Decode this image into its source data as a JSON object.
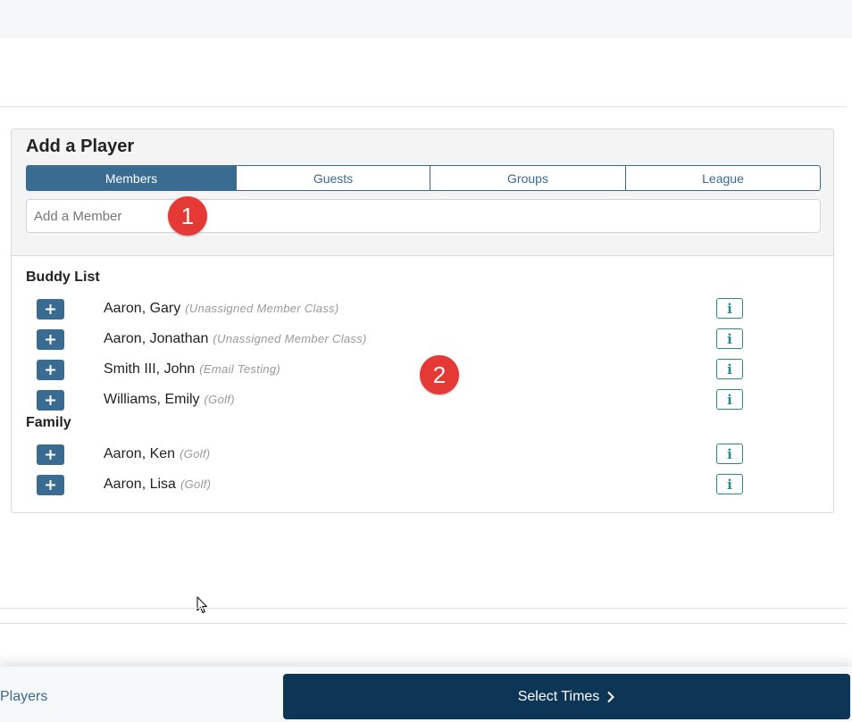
{
  "card": {
    "title": "Add a Player",
    "tabs": [
      {
        "label": "Members",
        "active": true
      },
      {
        "label": "Guests",
        "active": false
      },
      {
        "label": "Groups",
        "active": false
      },
      {
        "label": "League",
        "active": false
      }
    ],
    "search": {
      "placeholder": "Add a Member",
      "value": ""
    },
    "buddy_list": {
      "heading": "Buddy List",
      "members": [
        {
          "name": "Aaron, Gary",
          "class": "(Unassigned Member Class)"
        },
        {
          "name": "Aaron, Jonathan",
          "class": "(Unassigned Member Class)"
        },
        {
          "name": "Smith III, John",
          "class": "(Email Testing)"
        },
        {
          "name": "Williams, Emily",
          "class": "(Golf)"
        }
      ]
    },
    "family": {
      "heading": "Family",
      "members": [
        {
          "name": "Aaron, Ken",
          "class": "(Golf)"
        },
        {
          "name": "Aaron, Lisa",
          "class": "(Golf)"
        }
      ]
    },
    "add_icon": "plus-icon",
    "info_icon": "info-icon",
    "info_label": "i"
  },
  "markers": [
    "1",
    "2"
  ],
  "footer": {
    "players_link": "Players",
    "select_times_label": "Select Times",
    "select_times_icon": "chevron-right-icon"
  },
  "colors": {
    "primary": "#3a6b91",
    "dark_button": "#0d3556",
    "info_accent": "#2a8a8a",
    "marker_red": "#e53935"
  }
}
